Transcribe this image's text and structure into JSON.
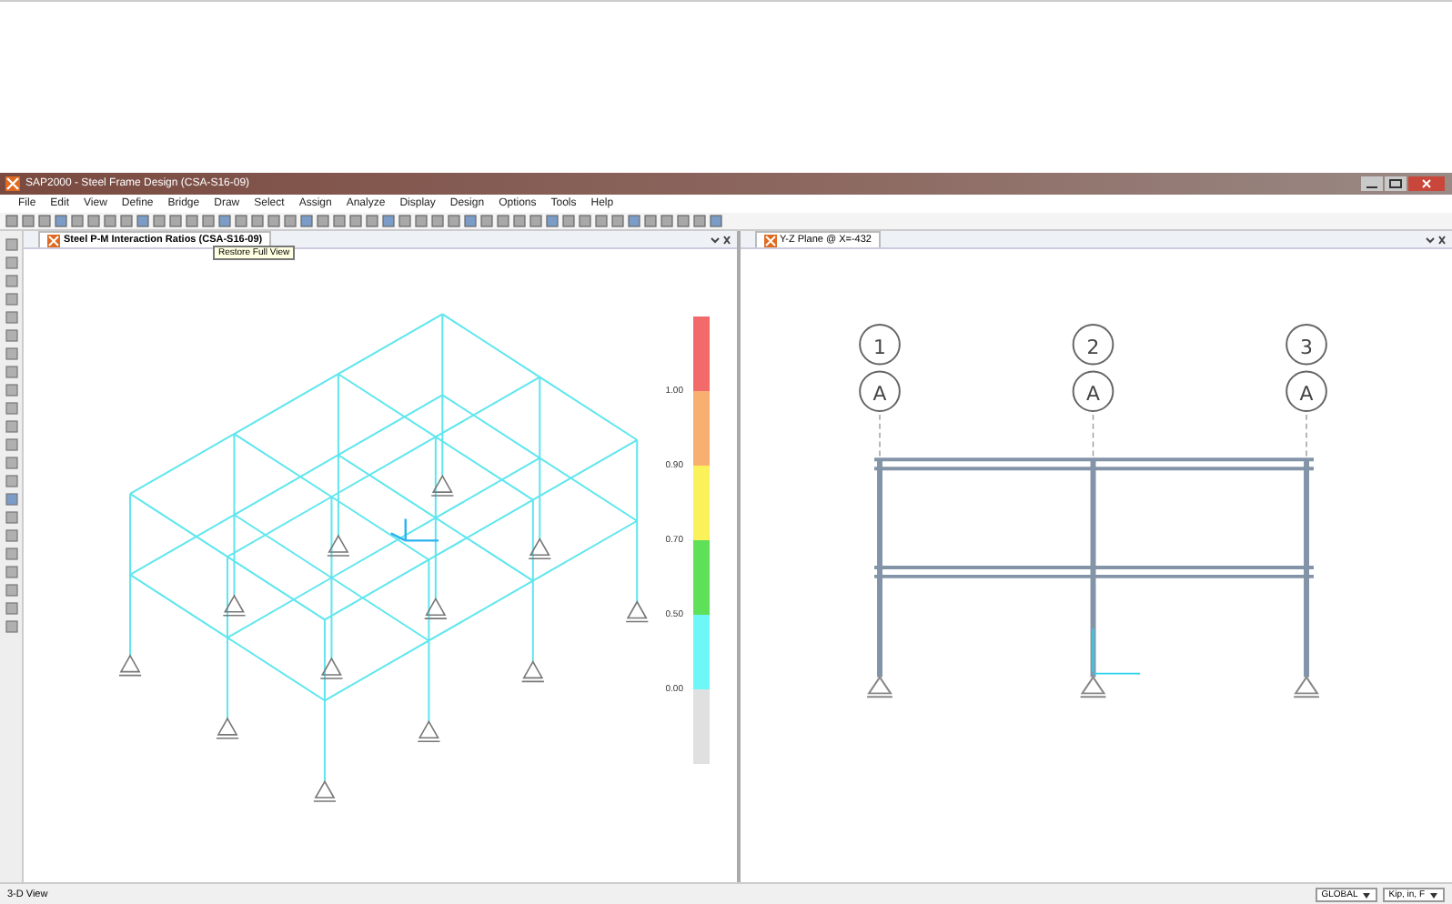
{
  "window": {
    "title": "SAP2000 - Steel Frame Design (CSA-S16-09)"
  },
  "menu": [
    "File",
    "Edit",
    "View",
    "Define",
    "Bridge",
    "Draw",
    "Select",
    "Assign",
    "Analyze",
    "Display",
    "Design",
    "Options",
    "Tools",
    "Help"
  ],
  "tooltip": "Restore Full View",
  "left_pane": {
    "title": "Steel P-M Interaction Ratios (CSA-S16-09)",
    "legend": [
      {
        "color": "#f26a6a",
        "label": "1.00"
      },
      {
        "color": "#f8b070",
        "label": "0.90"
      },
      {
        "color": "#fbf15a",
        "label": "0.70"
      },
      {
        "color": "#5ee05a",
        "label": "0.50"
      },
      {
        "color": "#6ff7f7",
        "label": "0.00"
      },
      {
        "color": "#e0e0e0"
      }
    ]
  },
  "right_pane": {
    "title": "Y-Z Plane @ X=-432",
    "grid_bubbles": [
      {
        "column": "1",
        "row": "A"
      },
      {
        "column": "2",
        "row": "A"
      },
      {
        "column": "3",
        "row": "A"
      }
    ]
  },
  "status_bar": {
    "view": "3-D View",
    "coord_system": "GLOBAL",
    "units": "Kip, in, F"
  }
}
